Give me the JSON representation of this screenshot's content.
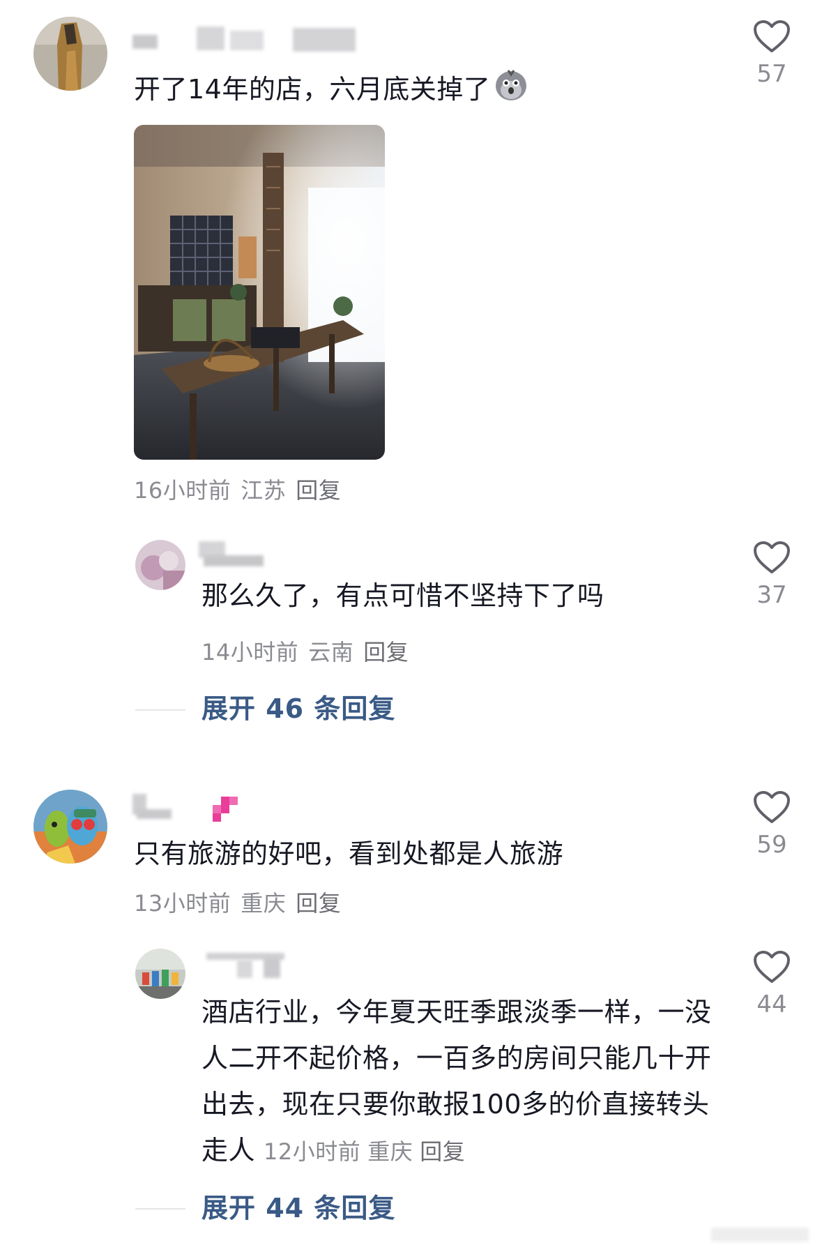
{
  "comments": [
    {
      "text": "开了14年的店，六月底关掉了",
      "emoji_icon": "hushed-bird-emoji",
      "has_photo": true,
      "meta": {
        "time": "16小时前",
        "location": "江苏",
        "reply": "回复"
      },
      "likes": "57",
      "replies": [
        {
          "text": "那么久了，有点可惜不坚持下了吗",
          "meta": {
            "time": "14小时前",
            "location": "云南",
            "reply": "回复"
          },
          "likes": "37"
        }
      ],
      "expand_label": "展开 46 条回复"
    },
    {
      "text": "只有旅游的好吧，看到处都是人旅游",
      "meta": {
        "time": "13小时前",
        "location": "重庆",
        "reply": "回复"
      },
      "likes": "59",
      "replies": [
        {
          "text": "酒店行业，今年夏天旺季跟淡季一样，一没人二开不起价格，一百多的房间只能几十开出去，现在只要你敢报100多的价直接转头走人",
          "meta": {
            "time": "12小时前",
            "location": "重庆",
            "reply": "回复"
          },
          "likes": "44"
        }
      ],
      "expand_label": "展开 44 条回复"
    }
  ],
  "colors": {
    "text": "#161823",
    "meta": "#8a8b91",
    "expand": "#3a5a86",
    "heart": "#5f6068"
  }
}
